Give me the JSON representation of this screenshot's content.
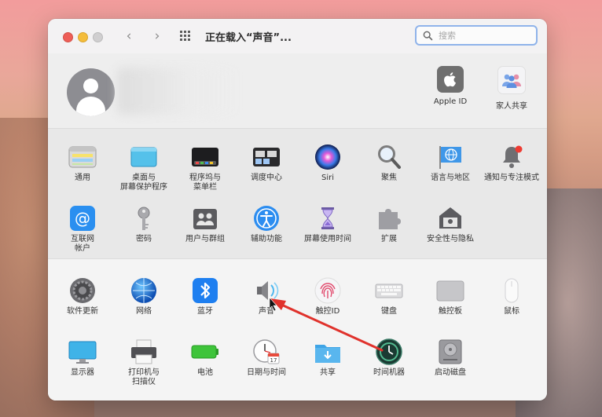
{
  "window": {
    "title": "正在载入“声音”...",
    "search_placeholder": "搜索"
  },
  "account": {
    "apple_id_label": "Apple ID",
    "family_label": "家人共享"
  },
  "section1": [
    {
      "label": "通用",
      "icon": "general-icon"
    },
    {
      "label": "桌面与\n屏幕保护程序",
      "icon": "desktop-screensaver-icon"
    },
    {
      "label": "程序坞与\n菜单栏",
      "icon": "dock-menubar-icon"
    },
    {
      "label": "调度中心",
      "icon": "mission-control-icon"
    },
    {
      "label": "Siri",
      "icon": "siri-icon"
    },
    {
      "label": "聚焦",
      "icon": "spotlight-icon"
    },
    {
      "label": "语言与地区",
      "icon": "language-region-icon"
    },
    {
      "label": "通知与专注模式",
      "icon": "notifications-icon"
    },
    {
      "label": "互联网\n帐户",
      "icon": "internet-accounts-icon"
    },
    {
      "label": "密码",
      "icon": "passwords-icon"
    },
    {
      "label": "用户与群组",
      "icon": "users-groups-icon"
    },
    {
      "label": "辅助功能",
      "icon": "accessibility-icon"
    },
    {
      "label": "屏幕使用时间",
      "icon": "screen-time-icon"
    },
    {
      "label": "扩展",
      "icon": "extensions-icon"
    },
    {
      "label": "安全性与隐私",
      "icon": "security-privacy-icon"
    }
  ],
  "section2": [
    {
      "label": "软件更新",
      "icon": "software-update-icon"
    },
    {
      "label": "网络",
      "icon": "network-icon"
    },
    {
      "label": "蓝牙",
      "icon": "bluetooth-icon"
    },
    {
      "label": "声音",
      "icon": "sound-icon"
    },
    {
      "label": "触控ID",
      "icon": "touch-id-icon"
    },
    {
      "label": "键盘",
      "icon": "keyboard-icon"
    },
    {
      "label": "触控板",
      "icon": "trackpad-icon"
    },
    {
      "label": "鼠标",
      "icon": "mouse-icon"
    },
    {
      "label": "显示器",
      "icon": "displays-icon"
    },
    {
      "label": "打印机与\n扫描仪",
      "icon": "printers-scanners-icon"
    },
    {
      "label": "电池",
      "icon": "battery-icon"
    },
    {
      "label": "日期与时间",
      "icon": "date-time-icon"
    },
    {
      "label": "共享",
      "icon": "sharing-icon"
    },
    {
      "label": "时间机器",
      "icon": "time-machine-icon"
    },
    {
      "label": "启动磁盘",
      "icon": "startup-disk-icon"
    }
  ],
  "colors": {
    "annotation_arrow": "#e0322c",
    "search_focus": "#8fb3ea"
  }
}
